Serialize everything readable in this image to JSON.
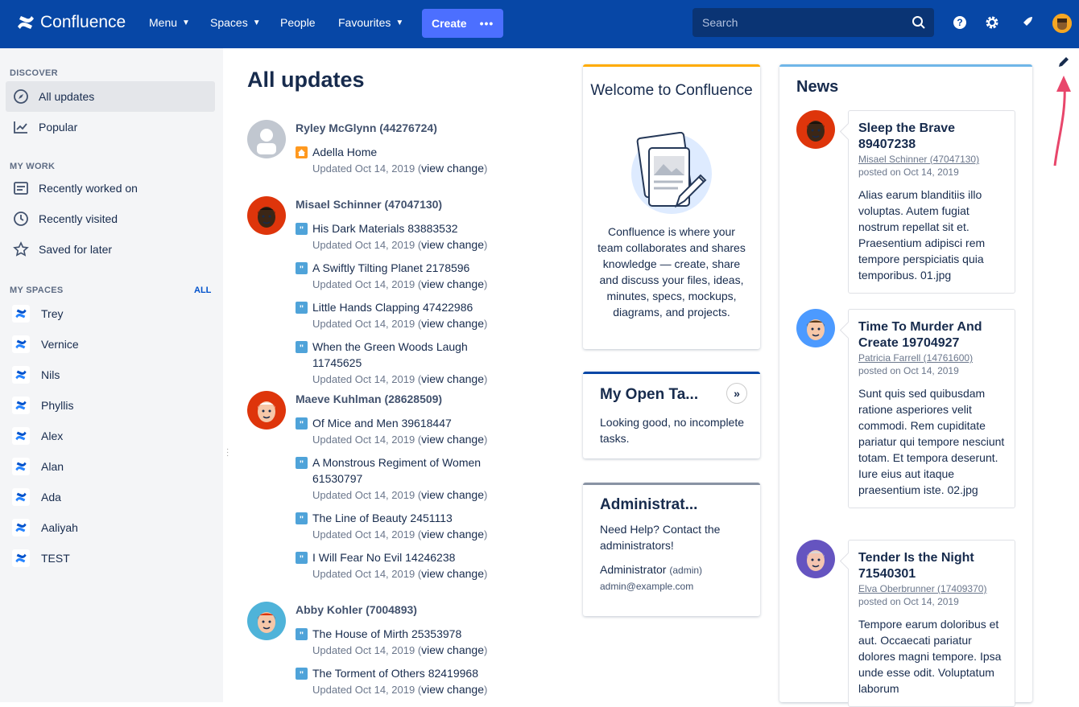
{
  "topbar": {
    "logo": "Confluence",
    "nav": [
      {
        "label": "Menu",
        "chevron": true
      },
      {
        "label": "Spaces",
        "chevron": true
      },
      {
        "label": "People",
        "chevron": false
      },
      {
        "label": "Favourites",
        "chevron": true
      }
    ],
    "create_label": "Create",
    "search_placeholder": "Search"
  },
  "sidebar": {
    "discover_heading": "DISCOVER",
    "discover": [
      {
        "label": "All updates",
        "icon": "compass-icon",
        "active": true
      },
      {
        "label": "Popular",
        "icon": "chart-icon",
        "active": false
      }
    ],
    "mywork_heading": "MY WORK",
    "mywork": [
      {
        "label": "Recently worked on",
        "icon": "document-icon"
      },
      {
        "label": "Recently visited",
        "icon": "clock-icon"
      },
      {
        "label": "Saved for later",
        "icon": "star-icon"
      }
    ],
    "myspaces_heading": "MY SPACES",
    "all_label": "ALL",
    "spaces": [
      "Trey",
      "Vernice",
      "Nils",
      "Phyllis",
      "Alex",
      "Alan",
      "Ada",
      "Aaliyah",
      "TEST"
    ]
  },
  "main": {
    "title": "All updates",
    "users": [
      {
        "name": "Ryley McGlynn (44276724)",
        "avatar": "default",
        "updates": [
          {
            "title": "Adella Home",
            "icon": "home",
            "meta": "Updated Oct 14, 2019 (",
            "link": "view change",
            "close": ")"
          }
        ]
      },
      {
        "name": "Misael Schinner (47047130)",
        "avatar": "dark",
        "updates": [
          {
            "title": "His Dark Materials 83883532",
            "icon": "quote",
            "meta": "Updated Oct 14, 2019 (",
            "link": "view change",
            "close": ")"
          },
          {
            "title": "A Swiftly Tilting Planet 2178596",
            "icon": "quote",
            "meta": "Updated Oct 14, 2019 (",
            "link": "view change",
            "close": ")"
          },
          {
            "title": "Little Hands Clapping 47422986",
            "icon": "quote",
            "meta": "Updated Oct 14, 2019 (",
            "link": "view change",
            "close": ")"
          },
          {
            "title": "When the Green Woods Laugh 11745625",
            "icon": "quote",
            "meta": "Updated Oct 14, 2019 (",
            "link": "view change",
            "close": ")"
          }
        ]
      },
      {
        "name": "Maeve Kuhlman (28628509)",
        "avatar": "santa",
        "updates": [
          {
            "title": "Of Mice and Men 39618447",
            "icon": "quote",
            "meta": "Updated Oct 14, 2019 (",
            "link": "view change",
            "close": ")"
          },
          {
            "title": "A Monstrous Regiment of Women 61530797",
            "icon": "quote",
            "meta": "Updated Oct 14, 2019 (",
            "link": "view change",
            "close": ")"
          },
          {
            "title": "The Line of Beauty 2451113",
            "icon": "quote",
            "meta": "Updated Oct 14, 2019 (",
            "link": "view change",
            "close": ")"
          },
          {
            "title": "I Will Fear No Evil 14246238",
            "icon": "quote",
            "meta": "Updated Oct 14, 2019 (",
            "link": "view change",
            "close": ")"
          }
        ]
      },
      {
        "name": "Abby Kohler (7004893)",
        "avatar": "red",
        "updates": [
          {
            "title": "The House of Mirth 25353978",
            "icon": "quote",
            "meta": "Updated Oct 14, 2019 (",
            "link": "view change",
            "close": ")"
          },
          {
            "title": "The Torment of Others 82419968",
            "icon": "quote",
            "meta": "Updated Oct 14, 2019 (",
            "link": "view change",
            "close": ")"
          }
        ]
      }
    ]
  },
  "welcome": {
    "title": "Welcome to Confluence",
    "description": "Confluence is where your team collaborates and shares knowledge — create, share and discuss your files, ideas, minutes, specs, mockups, diagrams, and projects."
  },
  "tasks": {
    "title": "My Open Ta...",
    "text": "Looking good, no incomplete tasks."
  },
  "admin": {
    "title": "Administrat...",
    "text": "Need Help? Contact the administrators!",
    "name": "Administrator",
    "role": "(admin)",
    "email": "admin@example.com"
  },
  "news": {
    "title": "News",
    "items": [
      {
        "title": "Sleep the Brave 89407238",
        "author": "Misael Schinner (47047130)",
        "date": "posted on Oct 14, 2019",
        "body": "Alias earum blanditiis illo voluptas. Autem fugiat nostrum repellat sit et. Praesentium adipisci rem tempore perspiciatis quia temporibus. 01.jpg",
        "avatar": "dark"
      },
      {
        "title": "Time To Murder And Create 19704927",
        "author": "Patricia Farrell (14761600)",
        "date": "posted on Oct 14, 2019",
        "body": "Sunt quis sed quibusdam ratione asperiores velit commodi. Rem cupiditate pariatur qui tempore nesciunt totam. Et tempora deserunt. Iure eius aut itaque praesentium iste. 02.jpg",
        "avatar": "blue"
      },
      {
        "title": "Tender Is the Night 71540301",
        "author": "Elva Oberbrunner (17409370)",
        "date": "posted on Oct 14, 2019",
        "body": "Tempore earum doloribus et aut. Occaecati pariatur dolores magni tempore. Ipsa unde esse odit. Voluptatum laborum",
        "avatar": "purple"
      }
    ]
  },
  "colors": {
    "topbar": "#0747a6",
    "create": "#4c6fff",
    "link": "#0052cc",
    "arrow": "#e8466b"
  }
}
